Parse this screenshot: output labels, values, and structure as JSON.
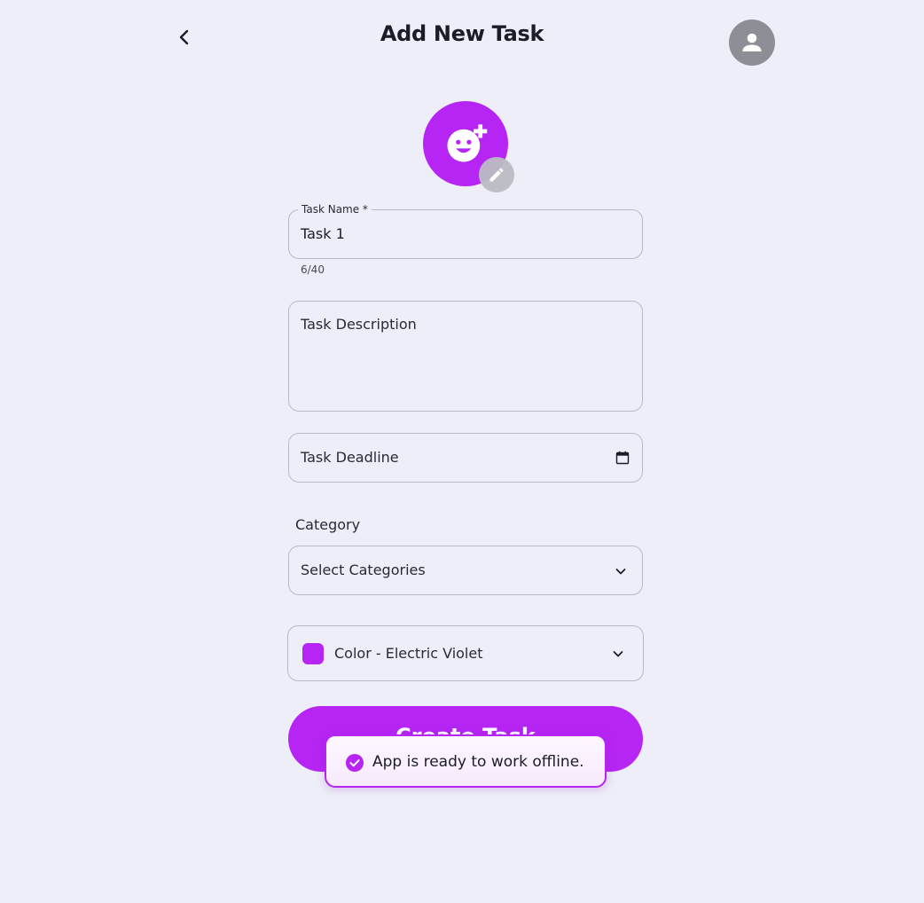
{
  "header": {
    "title": "Add New Task"
  },
  "form": {
    "task_name": {
      "legend": "Task Name *",
      "value": "Task 1",
      "counter": "6/40"
    },
    "description": {
      "placeholder": "Task Description"
    },
    "deadline": {
      "label": "Task Deadline"
    },
    "category": {
      "heading": "Category",
      "placeholder": "Select Categories"
    },
    "color": {
      "label": "Color - Electric Violet",
      "hex": "#b625f3"
    },
    "submit_label": "Create Task"
  },
  "toast": {
    "message": "App is ready to work offline."
  },
  "icons": {
    "back": "chevron-left-icon",
    "avatar": "person-icon",
    "task": "add-reaction-icon",
    "edit": "pencil-icon",
    "deadline": "calendar-icon",
    "dropdown": "chevron-down-icon",
    "toast": "check-circle-icon"
  },
  "colors": {
    "accent": "#b625f3",
    "background": "#edeef7",
    "avatar_bg": "#8e8f96"
  }
}
